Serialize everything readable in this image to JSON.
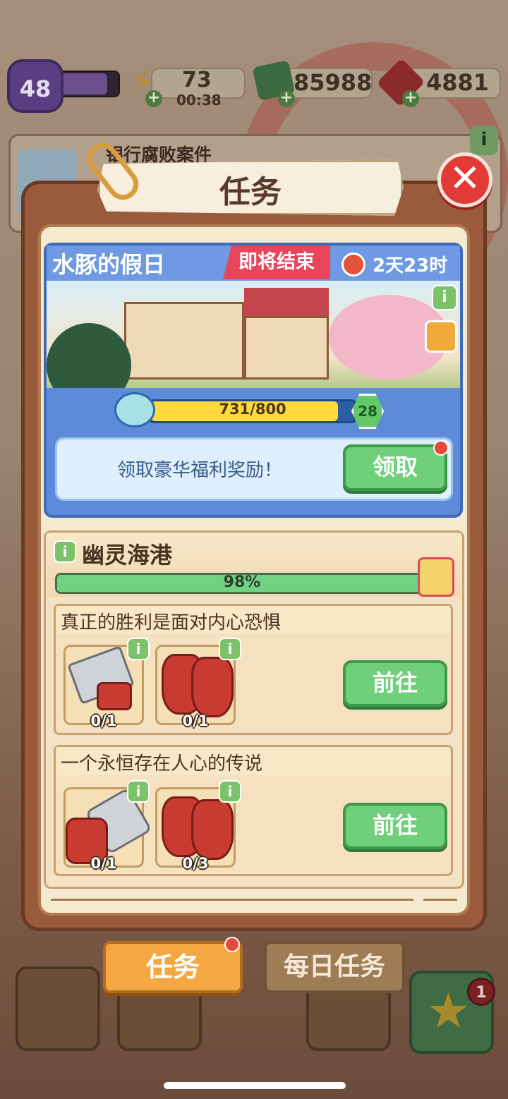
{
  "resources": {
    "level": "48",
    "energy": "73",
    "energy_timer": "00:38",
    "cash": "85988",
    "gems": "4881"
  },
  "background": {
    "board_title": "银行腐败案件"
  },
  "dialog": {
    "title": "任务",
    "close_symbol": "✕"
  },
  "event": {
    "title": "水豚的假日",
    "ending_tag": "即将结束",
    "timer": "2天23时",
    "progress_label": "731/800",
    "progress_fraction": 0.914,
    "level": "28",
    "reward_text": "领取豪华福利奖励！",
    "claim_label": "领取"
  },
  "chapter": {
    "title": "幽灵海港",
    "progress_label": "98%",
    "progress_fraction": 0.98,
    "tasks": [
      {
        "title": "真正的胜利是面对内心恐惧",
        "items": [
          {
            "icon": "hacksaw-icon",
            "count": "0/1"
          },
          {
            "icon": "red-gloves-icon",
            "count": "0/1"
          }
        ],
        "button_label": "前往"
      },
      {
        "title": "一个永恒存在人心的传说",
        "items": [
          {
            "icon": "chainsaw-icon",
            "count": "0/1"
          },
          {
            "icon": "red-gloves-icon",
            "count": "0/3"
          }
        ],
        "button_label": "前往"
      }
    ]
  },
  "tabs": {
    "tasks_label": "任务",
    "daily_label": "每日任务"
  },
  "star_badge": "1",
  "icons": {
    "info": "i",
    "star": "★",
    "plus": "+"
  },
  "colors": {
    "green_button": "#6fcf7a",
    "event_blue": "#5b8bd9",
    "ending_red": "#e8455c",
    "tab_orange": "#f4a842"
  }
}
